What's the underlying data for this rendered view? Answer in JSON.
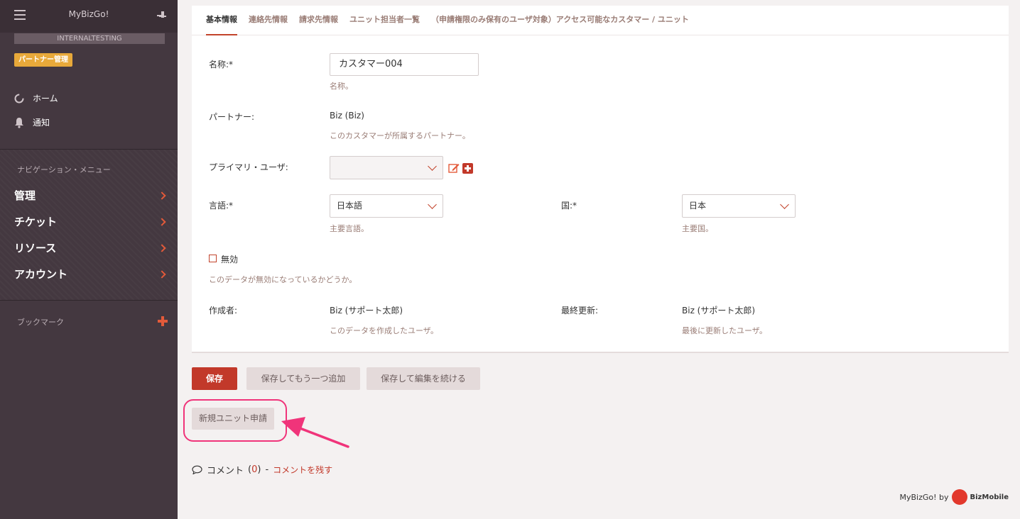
{
  "sidebar": {
    "app_title": "MyBizGo!",
    "env": "INTERNALTESTING",
    "partner_badge": "パートナー管理",
    "home": "ホーム",
    "notifications": "通知",
    "nav_heading": "ナビゲーション・メニュー",
    "nav_items": [
      {
        "label": "管理"
      },
      {
        "label": "チケット"
      },
      {
        "label": "リソース"
      },
      {
        "label": "アカウント"
      }
    ],
    "bookmark_heading": "ブックマーク"
  },
  "tabs": [
    {
      "label": "基本情報",
      "active": true
    },
    {
      "label": "連絡先情報"
    },
    {
      "label": "請求先情報"
    },
    {
      "label": "ユニット担当者一覧"
    },
    {
      "label": "（申請権限のみ保有のユーザ対象）アクセス可能なカスタマー / ユニット"
    }
  ],
  "form": {
    "name_label": "名称:*",
    "name_value": "カスタマー004",
    "name_help": "名称。",
    "partner_label": "パートナー:",
    "partner_value": "Biz (Biz)",
    "partner_help": "このカスタマーが所属するパートナー。",
    "primary_user_label": "プライマリ・ユーザ:",
    "primary_user_value": "",
    "language_label": "言語:*",
    "language_value": "日本語",
    "language_help": "主要言語。",
    "country_label": "国:*",
    "country_value": "日本",
    "country_help": "主要国。",
    "disabled_label": "無効",
    "disabled_help": "このデータが無効になっているかどうか。",
    "creator_label": "作成者:",
    "creator_value": "Biz (サポート太郎)",
    "creator_help": "このデータを作成したユーザ。",
    "updated_label": "最終更新:",
    "updated_value": "Biz (サポート太郎)",
    "updated_help": "最後に更新したユーザ。"
  },
  "actions": {
    "save": "保存",
    "save_add": "保存してもう一つ追加",
    "save_continue": "保存して編集を続ける",
    "new_unit_request": "新規ユニット申請"
  },
  "comments": {
    "label": "コメント",
    "open": "(",
    "count": "0",
    "close": ")",
    "separator": "-",
    "link": "コメントを残す"
  },
  "footer": {
    "text": "MyBizGo! by",
    "logo": "BizMobile"
  },
  "colors": {
    "accent": "#c2392a",
    "sidebar": "#443840",
    "highlight": "#f0347a"
  }
}
